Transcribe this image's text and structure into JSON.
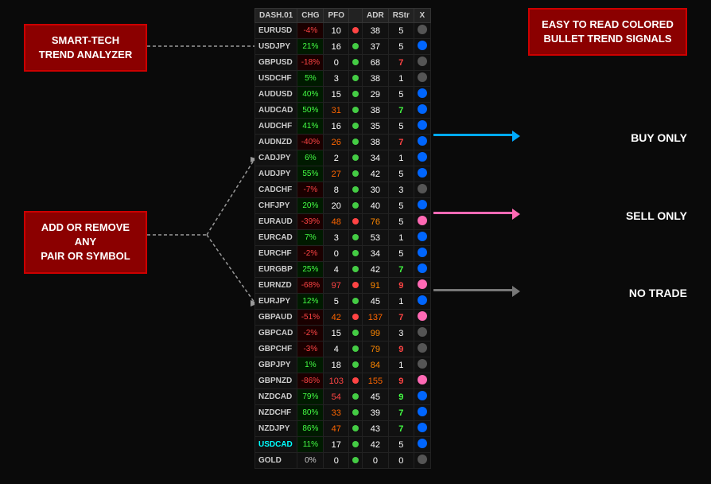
{
  "labels": {
    "analyzer": "SMART-TECH\nTREND ANALYZER",
    "add_remove": "ADD OR REMOVE ANY\nPAIR OR SYMBOL",
    "easy": "EASY TO READ COLORED\nBULLET TREND SIGNALS",
    "buy_only": "BUY ONLY",
    "sell_only": "SELL ONLY",
    "no_trade": "NO TRADE"
  },
  "table": {
    "headers": [
      "DASH.01",
      "CHG",
      "PFO",
      "",
      "ADR",
      "RStr",
      "X"
    ],
    "rows": [
      {
        "pair": "EURUSD",
        "chg": "-4%",
        "chg_type": "neg",
        "pfo": 10,
        "adr_dot": "red",
        "adr": 38,
        "rstr": 5,
        "rstr_type": "white",
        "bullet": "gray"
      },
      {
        "pair": "USDJPY",
        "chg": "21%",
        "chg_type": "pos",
        "pfo": 16,
        "adr_dot": "green",
        "adr": 37,
        "rstr": 5,
        "rstr_type": "white",
        "bullet": "blue"
      },
      {
        "pair": "GBPUSD",
        "chg": "-18%",
        "chg_type": "neg",
        "pfo": 0,
        "adr_dot": "green",
        "adr": 68,
        "rstr": 7,
        "rstr_type": "red",
        "bullet": "gray"
      },
      {
        "pair": "USDCHF",
        "chg": "5%",
        "chg_type": "pos",
        "pfo": 3,
        "adr_dot": "green",
        "adr": 38,
        "rstr": 1,
        "rstr_type": "white",
        "bullet": "gray"
      },
      {
        "pair": "AUDUSD",
        "chg": "40%",
        "chg_type": "pos",
        "pfo": 15,
        "adr_dot": "green",
        "adr": 29,
        "rstr": 5,
        "rstr_type": "white",
        "bullet": "blue"
      },
      {
        "pair": "AUDCAD",
        "chg": "50%",
        "chg_type": "pos",
        "pfo": 31,
        "adr_dot": "green",
        "adr": 38,
        "rstr": 7,
        "rstr_type": "green",
        "bullet": "blue"
      },
      {
        "pair": "AUDCHF",
        "chg": "41%",
        "chg_type": "pos",
        "pfo": 16,
        "adr_dot": "green",
        "adr": 35,
        "rstr": 5,
        "rstr_type": "white",
        "bullet": "blue"
      },
      {
        "pair": "AUDNZD",
        "chg": "-40%",
        "chg_type": "neg",
        "pfo": 26,
        "adr_dot": "green",
        "adr": 38,
        "rstr": 7,
        "rstr_type": "red",
        "bullet": "blue"
      },
      {
        "pair": "CADJPY",
        "chg": "6%",
        "chg_type": "pos",
        "pfo": 2,
        "adr_dot": "green",
        "adr": 34,
        "rstr": 1,
        "rstr_type": "white",
        "bullet": "blue"
      },
      {
        "pair": "AUDJPY",
        "chg": "55%",
        "chg_type": "pos",
        "pfo": 27,
        "adr_dot": "green",
        "adr": 42,
        "rstr": 5,
        "rstr_type": "white",
        "bullet": "blue"
      },
      {
        "pair": "CADCHF",
        "chg": "-7%",
        "chg_type": "neg",
        "pfo": 8,
        "adr_dot": "green",
        "adr": 30,
        "rstr": 3,
        "rstr_type": "white",
        "bullet": "gray"
      },
      {
        "pair": "CHFJPY",
        "chg": "20%",
        "chg_type": "pos",
        "pfo": 20,
        "adr_dot": "green",
        "adr": 40,
        "rstr": 5,
        "rstr_type": "white",
        "bullet": "blue"
      },
      {
        "pair": "EURAUD",
        "chg": "-39%",
        "chg_type": "neg",
        "pfo": 48,
        "adr_dot": "red",
        "adr": 76,
        "rstr": 5,
        "rstr_type": "white",
        "bullet": "pink"
      },
      {
        "pair": "EURCAD",
        "chg": "7%",
        "chg_type": "pos",
        "pfo": 3,
        "adr_dot": "green",
        "adr": 53,
        "rstr": 1,
        "rstr_type": "white",
        "bullet": "blue"
      },
      {
        "pair": "EURCHF",
        "chg": "-2%",
        "chg_type": "neg",
        "pfo": 0,
        "adr_dot": "green",
        "adr": 34,
        "rstr": 5,
        "rstr_type": "white",
        "bullet": "blue"
      },
      {
        "pair": "EURGBP",
        "chg": "25%",
        "chg_type": "pos",
        "pfo": 4,
        "adr_dot": "green",
        "adr": 42,
        "rstr": 7,
        "rstr_type": "green",
        "bullet": "blue"
      },
      {
        "pair": "EURNZD",
        "chg": "-68%",
        "chg_type": "neg",
        "pfo": 97,
        "adr_dot": "red",
        "adr": 91,
        "rstr": 9,
        "rstr_type": "red",
        "bullet": "pink"
      },
      {
        "pair": "EURJPY",
        "chg": "12%",
        "chg_type": "pos",
        "pfo": 5,
        "adr_dot": "green",
        "adr": 45,
        "rstr": 1,
        "rstr_type": "white",
        "bullet": "blue"
      },
      {
        "pair": "GBPAUD",
        "chg": "-51%",
        "chg_type": "neg",
        "pfo": 42,
        "adr_dot": "red",
        "adr": 137,
        "rstr": 7,
        "rstr_type": "red",
        "bullet": "pink"
      },
      {
        "pair": "GBPCAD",
        "chg": "-2%",
        "chg_type": "neg",
        "pfo": 15,
        "adr_dot": "green",
        "adr": 99,
        "rstr": 3,
        "rstr_type": "white",
        "bullet": "gray"
      },
      {
        "pair": "GBPCHF",
        "chg": "-3%",
        "chg_type": "neg",
        "pfo": 4,
        "adr_dot": "green",
        "adr": 79,
        "rstr": 9,
        "rstr_type": "red",
        "bullet": "gray"
      },
      {
        "pair": "GBPJPY",
        "chg": "1%",
        "chg_type": "pos",
        "pfo": 18,
        "adr_dot": "green",
        "adr": 84,
        "rstr": 1,
        "rstr_type": "white",
        "bullet": "gray"
      },
      {
        "pair": "GBPNZD",
        "chg": "-86%",
        "chg_type": "neg",
        "pfo": 103,
        "adr_dot": "red",
        "adr": 155,
        "rstr": 9,
        "rstr_type": "red",
        "bullet": "pink"
      },
      {
        "pair": "NZDCAD",
        "chg": "79%",
        "chg_type": "pos",
        "pfo": 54,
        "adr_dot": "green",
        "adr": 45,
        "rstr": 9,
        "rstr_type": "green",
        "bullet": "blue"
      },
      {
        "pair": "NZDCHF",
        "chg": "80%",
        "chg_type": "pos",
        "pfo": 33,
        "adr_dot": "green",
        "adr": 39,
        "rstr": 7,
        "rstr_type": "green",
        "bullet": "blue"
      },
      {
        "pair": "NZDJPY",
        "chg": "86%",
        "chg_type": "pos",
        "pfo": 47,
        "adr_dot": "green",
        "adr": 43,
        "rstr": 7,
        "rstr_type": "green",
        "bullet": "blue"
      },
      {
        "pair": "USDCAD",
        "chg": "11%",
        "chg_type": "pos",
        "pfo": 17,
        "adr_dot": "green",
        "adr": 42,
        "rstr": 5,
        "rstr_type": "white",
        "bullet": "blue",
        "pair_style": "cyan"
      },
      {
        "pair": "GOLD",
        "chg": "0%",
        "chg_type": "neutral",
        "pfo": 0,
        "adr_dot": "green",
        "adr": 0,
        "rstr": 0,
        "rstr_type": "white",
        "bullet": "gray"
      }
    ]
  }
}
